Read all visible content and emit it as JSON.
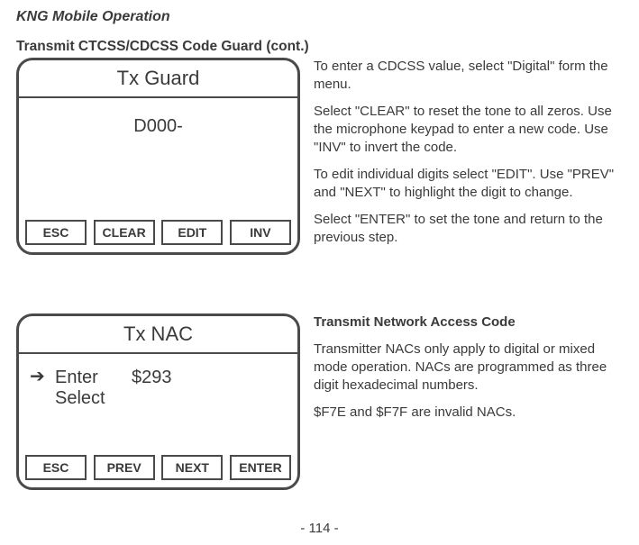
{
  "header": "KNG Mobile Operation",
  "section1_title": "Transmit CTCSS/CDCSS Code Guard (cont.)",
  "screen1": {
    "title": "Tx Guard",
    "value": "D000-",
    "keys": [
      "ESC",
      "CLEAR",
      "EDIT",
      "INV"
    ]
  },
  "text1": {
    "p1": "To enter a CDCSS value, select \"Digital\" form the menu.",
    "p2": "Select \"CLEAR\" to reset the tone to all zeros. Use the microphone keypad to enter a new code. Use \"INV\" to invert the code.",
    "p3": "To edit individual digits select \"EDIT\". Use \"PREV\" and \"NEXT\" to highlight the digit to change.",
    "p4": "Select \"ENTER\" to set the tone and return to the previous step."
  },
  "screen2": {
    "title": "Tx NAC",
    "line1_label": "Enter",
    "line1_value": "$293",
    "line2_label": "Select",
    "keys": [
      "ESC",
      "PREV",
      "NEXT",
      "ENTER"
    ]
  },
  "text2": {
    "heading": "Transmit Network Access Code",
    "p1": "Transmitter NACs only apply to digital or mixed mode operation. NACs are programmed as three digit hexadecimal numbers.",
    "p2": "$F7E and $F7F are invalid NACs."
  },
  "page_number": "- 114 -"
}
